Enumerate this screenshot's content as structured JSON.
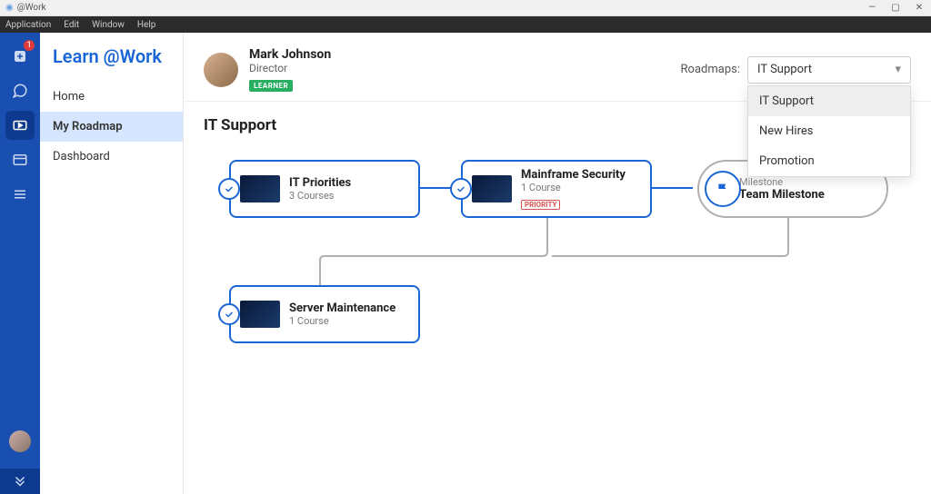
{
  "window": {
    "title": "@Work"
  },
  "menubar": {
    "items": [
      "Application",
      "Edit",
      "Window",
      "Help"
    ]
  },
  "rail": {
    "badge": "1"
  },
  "brand": "Learn @Work",
  "nav": {
    "items": [
      {
        "label": "Home"
      },
      {
        "label": "My Roadmap"
      },
      {
        "label": "Dashboard"
      }
    ],
    "active_index": 1
  },
  "user": {
    "name": "Mark Johnson",
    "role": "Director",
    "badge": "LEARNER"
  },
  "roadmaps": {
    "label": "Roadmaps:",
    "selected": "IT Support",
    "options": [
      "IT Support",
      "New Hires",
      "Promotion"
    ],
    "hover_index": 0
  },
  "section_title": "IT Support",
  "cards": [
    {
      "title": "IT Priorities",
      "meta": "3 Courses"
    },
    {
      "title": "Mainframe Security",
      "meta": "1 Course",
      "priority": "PRIORITY"
    },
    {
      "title": "Server Maintenance",
      "meta": "1 Course"
    }
  ],
  "milestone": {
    "label": "Milestone",
    "title": "Team Milestone"
  }
}
